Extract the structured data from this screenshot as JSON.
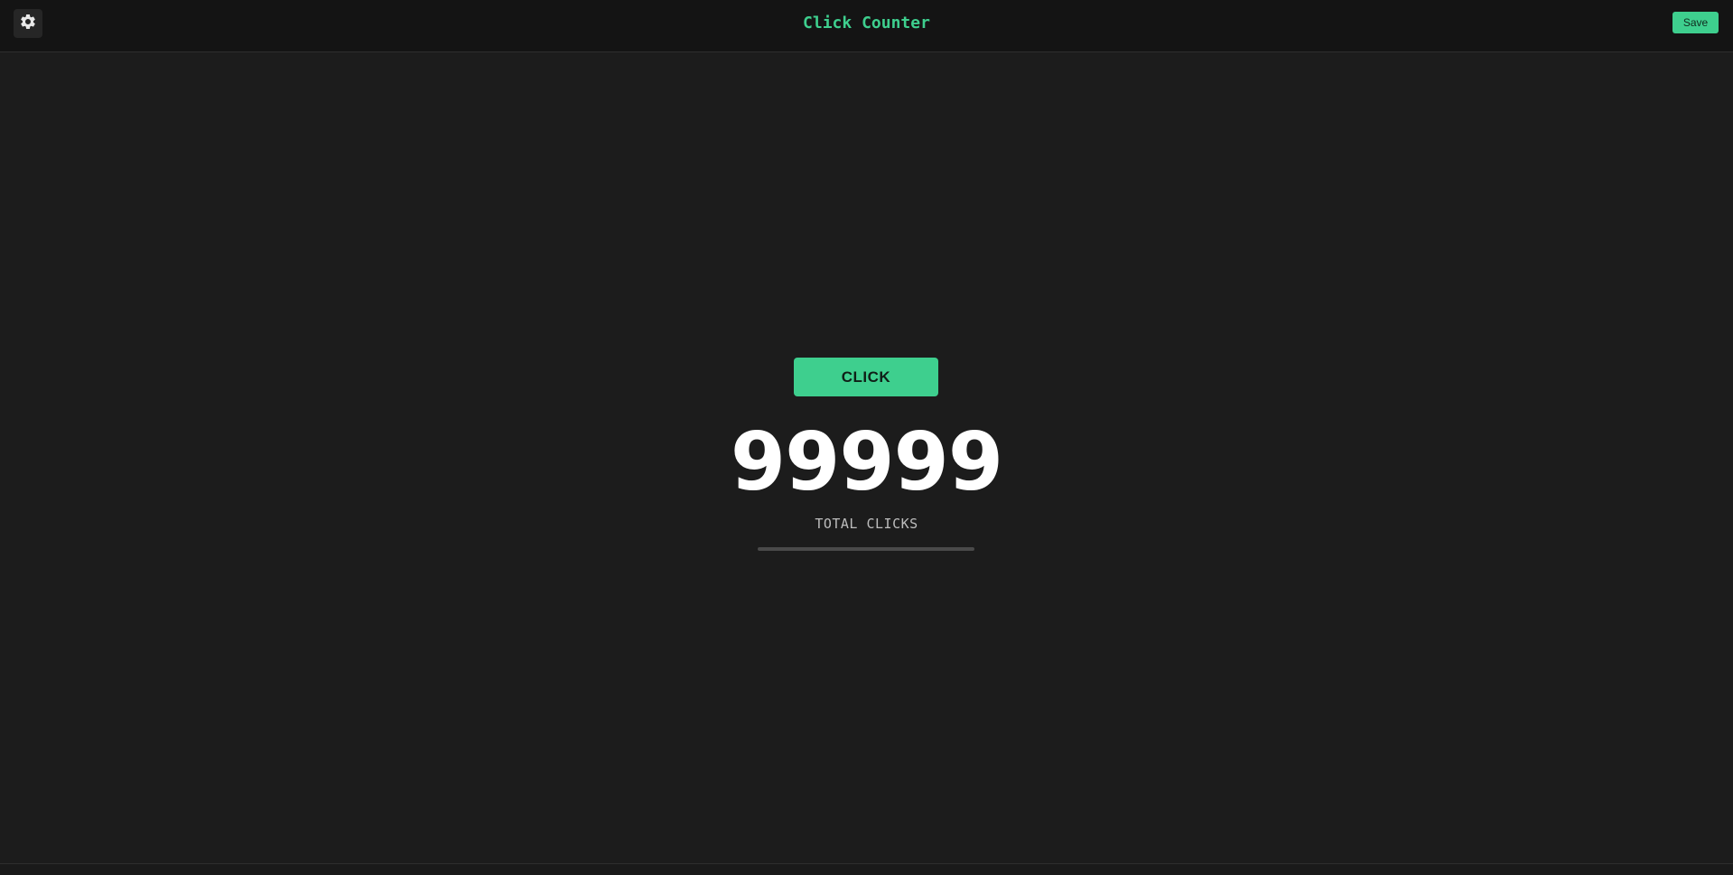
{
  "header": {
    "title": "Click Counter",
    "save_label": "Save",
    "settings_icon": "gear-icon"
  },
  "main": {
    "click_label": "CLICK",
    "count": "99999",
    "count_label": "TOTAL CLICKS",
    "progress_fraction": 0
  },
  "footer": {
    "text": ""
  },
  "colors": {
    "background": "#1c1c1c",
    "topbar": "#141414",
    "accent": "#3ecf8e",
    "count_text": "#ffffff"
  }
}
